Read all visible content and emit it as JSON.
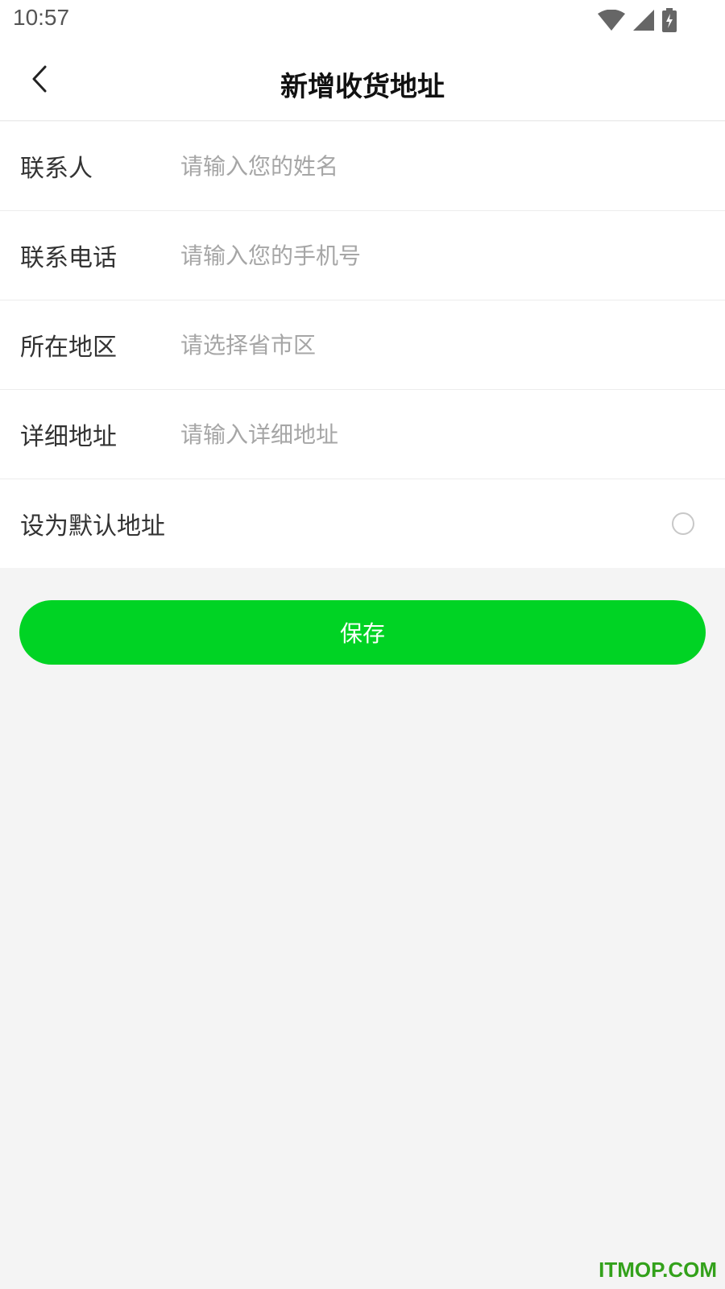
{
  "status_bar": {
    "time": "10:57",
    "icons": [
      "wifi-icon",
      "signal-icon",
      "battery-charging-icon"
    ]
  },
  "header": {
    "title": "新增收货地址",
    "back_icon": "chevron-left-icon"
  },
  "form": {
    "contact": {
      "label": "联系人",
      "placeholder": "请输入您的姓名",
      "value": ""
    },
    "phone": {
      "label": "联系电话",
      "placeholder": "请输入您的手机号",
      "value": ""
    },
    "region": {
      "label": "所在地区",
      "placeholder": "请选择省市区",
      "value": ""
    },
    "detail": {
      "label": "详细地址",
      "placeholder": "请输入详细地址",
      "value": ""
    },
    "default_address": {
      "label": "设为默认地址",
      "checked": false
    }
  },
  "actions": {
    "save_label": "保存"
  },
  "colors": {
    "accent": "#00d324",
    "background": "#f4f4f4",
    "placeholder": "#a6a6a6"
  },
  "watermark": "ITMOP.COM"
}
